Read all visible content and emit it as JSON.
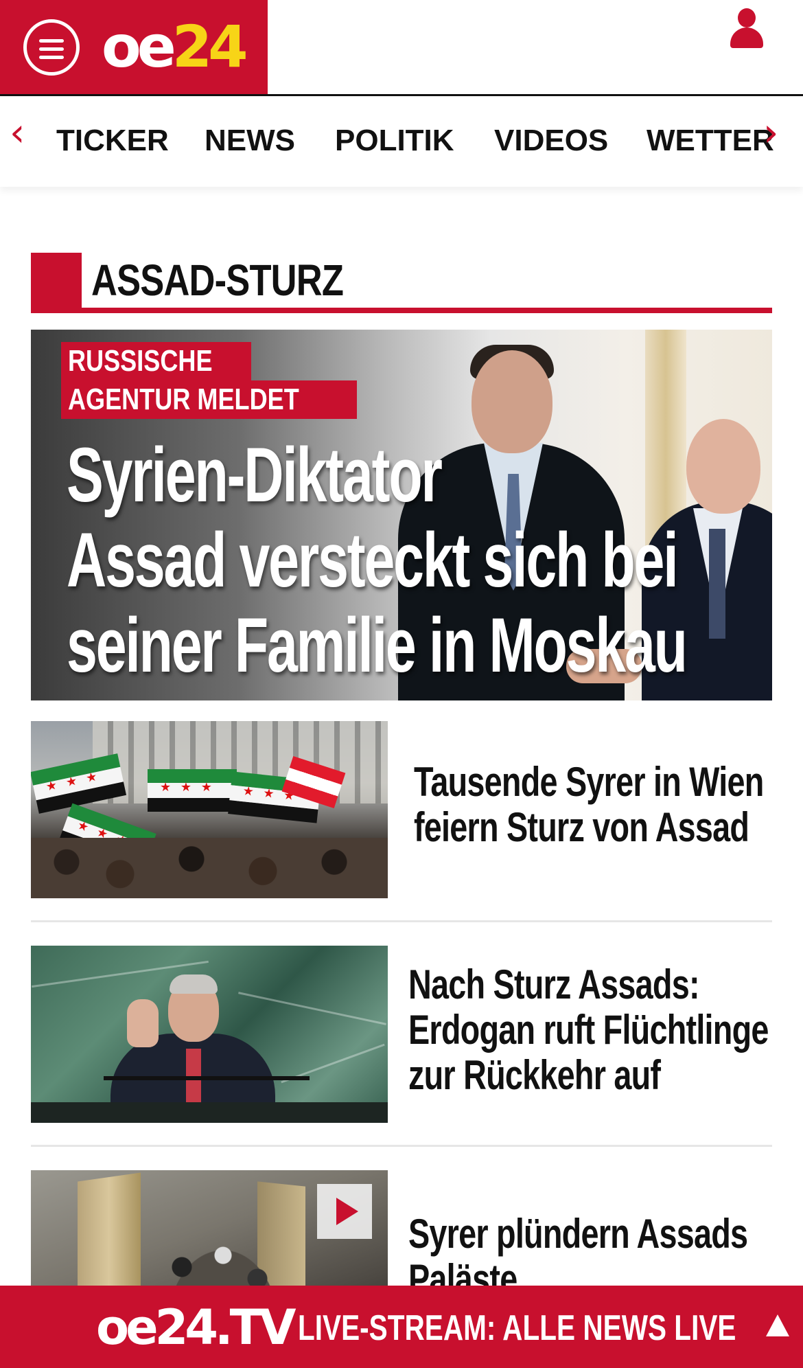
{
  "header": {
    "logo_oe": "oe",
    "logo_num": "24",
    "menu_icon": "hamburger-menu-icon",
    "user_icon": "user-icon",
    "brand_color": "#c8102e",
    "logo_accent_color": "#f7d417"
  },
  "nav": {
    "tabs": [
      {
        "label": "TICKER"
      },
      {
        "label": "NEWS"
      },
      {
        "label": "POLITIK"
      },
      {
        "label": "VIDEOS"
      },
      {
        "label": "WETTER"
      }
    ],
    "prev_icon": "chevron-left-icon",
    "next_icon": "chevron-right-icon"
  },
  "section": {
    "title": "ASSAD-STURZ"
  },
  "hero": {
    "kicker_line1": "RUSSISCHE",
    "kicker_line2": "AGENTUR MELDET",
    "title_lines": [
      "Syrien-Diktator",
      "Assad versteckt sich bei",
      "seiner Familie in Moskau"
    ]
  },
  "articles": [
    {
      "title_lines": [
        "Tausende Syrer in Wien",
        "feiern Sturz von Assad"
      ],
      "has_video": false
    },
    {
      "title_lines": [
        "Nach Sturz Assads:",
        "Erdogan ruft Flüchtlinge",
        "zur Rückkehr auf"
      ],
      "has_video": false
    },
    {
      "title_lines": [
        "Syrer plündern Assads",
        "Paläste"
      ],
      "has_video": true,
      "video_icon": "play-icon"
    }
  ],
  "live_bar": {
    "logo": "oe24.TV",
    "text": "LIVE-STREAM:  ALLE NEWS LIVE",
    "arrow_icon": "arrow-up-icon"
  }
}
